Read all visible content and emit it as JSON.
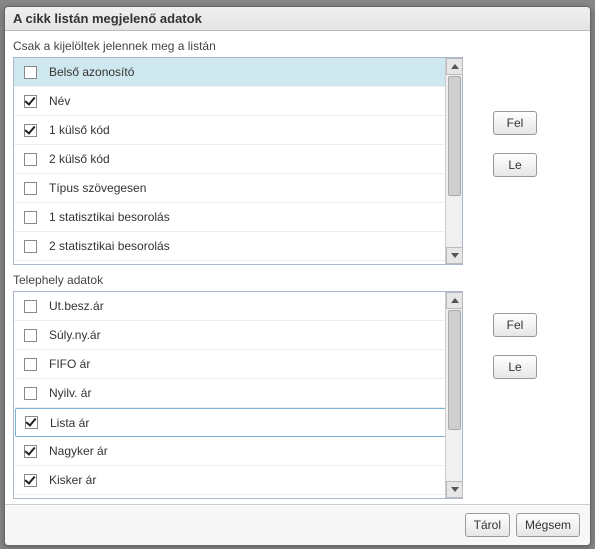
{
  "title": "A cikk listán megjelenő adatok",
  "section1": {
    "label": "Csak a kijelöltek jelennek meg a listán",
    "items": [
      {
        "label": "Belső azonosító",
        "checked": false,
        "highlight": true
      },
      {
        "label": "Név",
        "checked": true
      },
      {
        "label": "1 külső kód",
        "checked": true
      },
      {
        "label": "2 külső kód",
        "checked": false
      },
      {
        "label": "Típus szövegesen",
        "checked": false
      },
      {
        "label": "1 statisztikai besorolás",
        "checked": false
      },
      {
        "label": "2 statisztikai besorolás",
        "checked": false
      }
    ]
  },
  "section2": {
    "label": "Telephely adatok",
    "items": [
      {
        "label": "Ut.besz.ár",
        "checked": false
      },
      {
        "label": "Súly.ny.ár",
        "checked": false
      },
      {
        "label": "FIFO  ár",
        "checked": false
      },
      {
        "label": "Nyilv. ár",
        "checked": false
      },
      {
        "label": "Lista ár",
        "checked": true,
        "selected": true
      },
      {
        "label": "Nagyker ár",
        "checked": true
      },
      {
        "label": "Kisker ár",
        "checked": true
      }
    ]
  },
  "buttons": {
    "up": "Fel",
    "down": "Le",
    "save": "Tárol",
    "cancel": "Mégsem"
  }
}
